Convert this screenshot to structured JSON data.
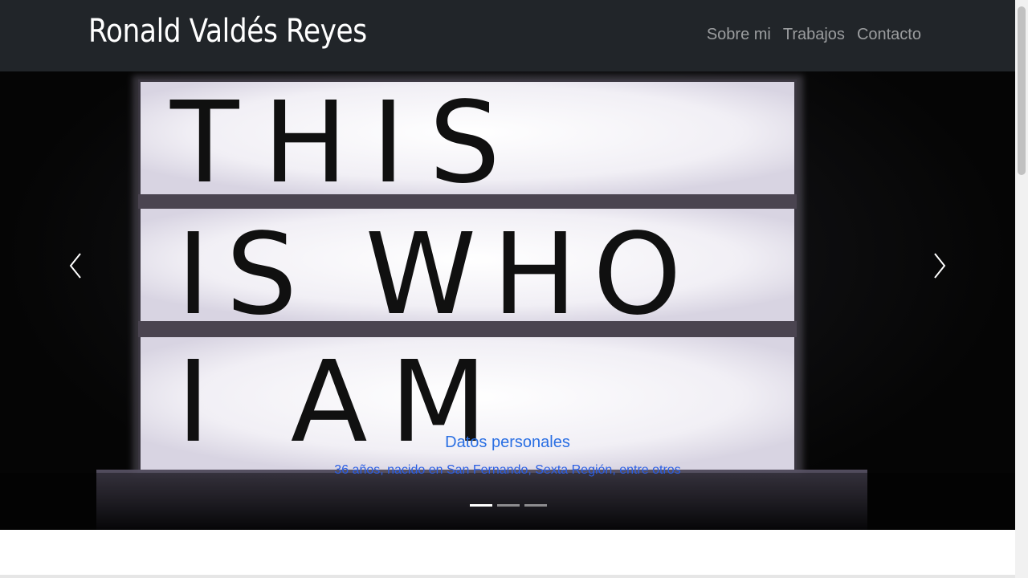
{
  "navbar": {
    "brand": "Ronald Valdés Reyes",
    "links": [
      "Sobre mi",
      "Trabajos",
      "Contacto"
    ],
    "background": "#212529"
  },
  "carousel": {
    "image_text": [
      "THIS",
      "IS WHO",
      "I AM"
    ],
    "caption_title": "Datos personales",
    "caption_text": "36 años, nacido en San Fernando, Sexta Región, entre otros",
    "caption_color": "#2a6fe3",
    "prev_icon": "chevron-left-icon",
    "next_icon": "chevron-right-icon",
    "slides_count": 3,
    "active_slide": 1
  }
}
